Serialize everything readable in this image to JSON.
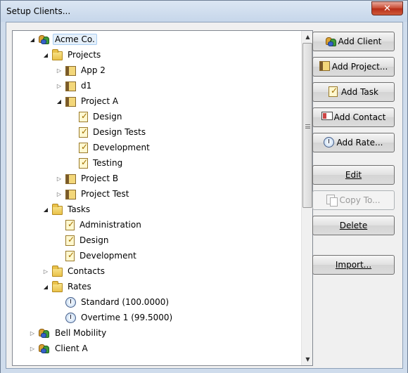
{
  "window": {
    "title": "Setup Clients...",
    "close_glyph": "✕"
  },
  "tree": {
    "rows": [
      {
        "label": "Acme Co.",
        "icon": "client-icon",
        "expander": "◢",
        "selected": true
      },
      {
        "label": "Projects",
        "icon": "folder-icon",
        "expander": "◢"
      },
      {
        "label": "App 2",
        "icon": "project-icon",
        "expander": "▷"
      },
      {
        "label": "d1",
        "icon": "project-icon",
        "expander": "▷"
      },
      {
        "label": "Project A",
        "icon": "project-icon",
        "expander": "◢"
      },
      {
        "label": "Design",
        "icon": "task-icon",
        "expander": ""
      },
      {
        "label": "Design Tests",
        "icon": "task-icon",
        "expander": ""
      },
      {
        "label": "Development",
        "icon": "task-icon",
        "expander": ""
      },
      {
        "label": "Testing",
        "icon": "task-icon",
        "expander": ""
      },
      {
        "label": "Project B",
        "icon": "project-icon",
        "expander": "▷"
      },
      {
        "label": "Project Test",
        "icon": "project-icon",
        "expander": "▷"
      },
      {
        "label": "Tasks",
        "icon": "folder-icon",
        "expander": "◢"
      },
      {
        "label": "Administration",
        "icon": "task-icon",
        "expander": ""
      },
      {
        "label": "Design",
        "icon": "task-icon",
        "expander": ""
      },
      {
        "label": "Development",
        "icon": "task-icon",
        "expander": ""
      },
      {
        "label": "Contacts",
        "icon": "folder-icon",
        "expander": "▷"
      },
      {
        "label": "Rates",
        "icon": "folder-icon",
        "expander": "◢"
      },
      {
        "label": "Standard (100.0000)",
        "icon": "rate-icon",
        "expander": ""
      },
      {
        "label": "Overtime 1 (99.5000)",
        "icon": "rate-icon",
        "expander": ""
      },
      {
        "label": "Bell Mobility",
        "icon": "client-icon",
        "expander": "▷"
      },
      {
        "label": "Client A",
        "icon": "client-icon",
        "expander": "▷"
      }
    ]
  },
  "buttons": {
    "add_client": "Add Client",
    "add_project": "Add Project...",
    "add_task": "Add Task",
    "add_contact": "Add Contact",
    "add_rate": "Add Rate...",
    "edit": "Edit",
    "copy_to": "Copy To...",
    "delete": "Delete",
    "import": "Import..."
  },
  "scrollbar": {
    "up_glyph": "▲",
    "down_glyph": "▼",
    "position": 0.0
  }
}
